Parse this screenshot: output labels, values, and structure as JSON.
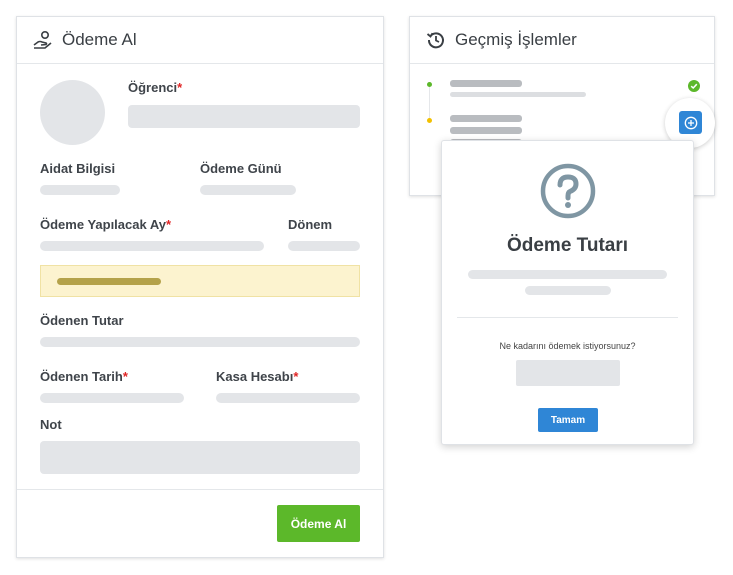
{
  "payment_card": {
    "title": "Ödeme Al",
    "icon": "hand-coin-icon",
    "student_label": "Öğrenci",
    "dues_label": "Aidat Bilgisi",
    "payment_day_label": "Ödeme Günü",
    "month_label": "Ödeme Yapılacak Ay",
    "period_label": "Dönem",
    "paid_amount_label": "Ödenen Tutar",
    "paid_date_label": "Ödenen Tarih",
    "cash_account_label": "Kasa Hesabı",
    "note_label": "Not",
    "required_mark": "*",
    "submit_label": "Ödeme Al",
    "colors": {
      "submit": "#5cb82a",
      "warning_bg": "#fcf3cf",
      "required": "#e02424"
    }
  },
  "history_card": {
    "title": "Geçmiş İşlemler",
    "icon": "history-icon",
    "status_icons": [
      "check-circle-icon"
    ],
    "add_icon": "plus-circle-icon"
  },
  "dialog": {
    "icon": "question-circle-icon",
    "title": "Ödeme Tutarı",
    "prompt": "Ne kadarını ödemek istiyorsunuz?",
    "confirm_label": "Tamam",
    "colors": {
      "confirm": "#2f86d6"
    }
  }
}
